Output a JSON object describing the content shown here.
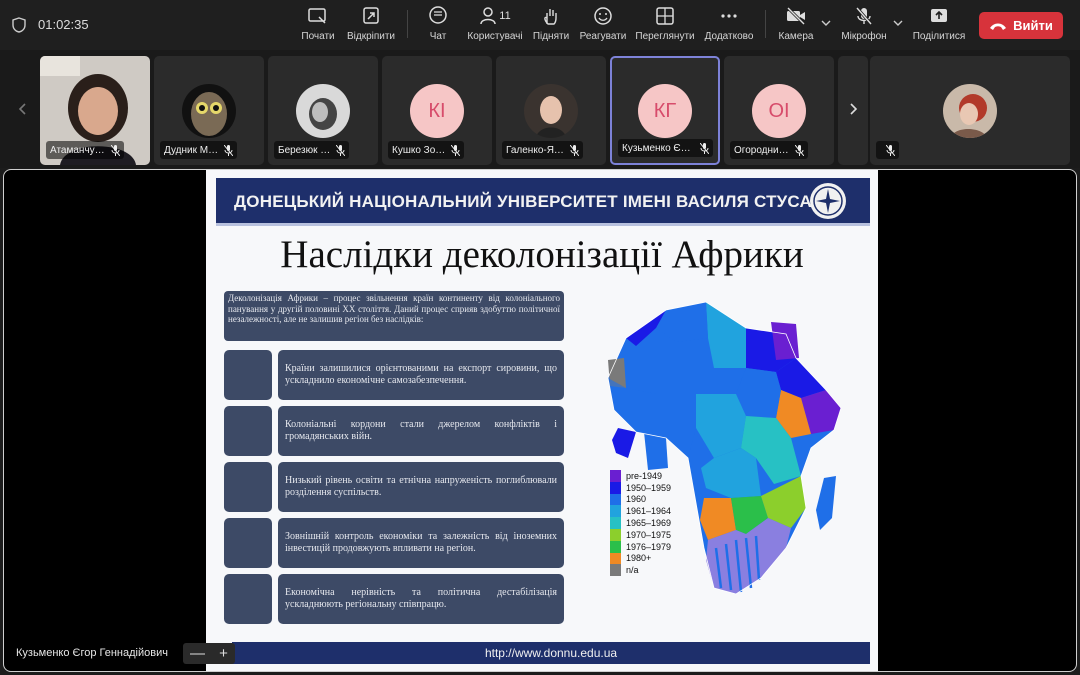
{
  "topbar": {
    "timer": "01:02:35",
    "tools": [
      {
        "label": "Почати",
        "icon": "record-screen-icon"
      },
      {
        "label": "Відкріпити",
        "icon": "unpin-icon"
      },
      {
        "label": "Чат",
        "icon": "chat-icon"
      },
      {
        "label": "Користувачі",
        "icon": "users-icon",
        "count": "11"
      },
      {
        "label": "Підняти",
        "icon": "raise-hand-icon"
      },
      {
        "label": "Реагувати",
        "icon": "smile-icon"
      },
      {
        "label": "Переглянути",
        "icon": "grid-view-icon"
      },
      {
        "label": "Додатково",
        "icon": "more-icon"
      },
      {
        "label": "Камера",
        "icon": "camera-off-icon"
      },
      {
        "label": "Мікрофон",
        "icon": "mic-off-icon"
      },
      {
        "label": "Поділитися",
        "icon": "share-screen-icon"
      }
    ],
    "leave_label": "Вийти"
  },
  "participants": [
    {
      "name": "Атаманчу…",
      "type": "photo"
    },
    {
      "name": "Дудник М…",
      "type": "photo"
    },
    {
      "name": "Березюк …",
      "type": "photo"
    },
    {
      "name": "Кушко Зо…",
      "type": "initials",
      "initials": "КІ"
    },
    {
      "name": "Галенко-Я…",
      "type": "photo"
    },
    {
      "name": "Кузьменко Єг…",
      "type": "initials",
      "initials": "КГ",
      "active": true
    },
    {
      "name": "Огородни…",
      "type": "initials",
      "initials": "ОІ"
    },
    {
      "name": "",
      "type": "photo"
    }
  ],
  "slide": {
    "banner": "ДОНЕЦЬКИЙ НАЦІОНАЛЬНИЙ УНІВЕРСИТЕТ ІМЕНІ ВАСИЛЯ СТУСА",
    "title": "Наслідки деколонізації Африки",
    "intro": "Деколонізація Африки – процес звільнення країн континенту від колоніального панування у другій половині XX століття. Даний процес сприяв здобуттю політичної незалежності, але не залишив регіон без наслідків:",
    "points": [
      "Країни залишилися орієнтованими на експорт сировини, що ускладнило економічне самозабезпечення.",
      "Колоніальні кордони стали джерелом конфліктів і громадянських війн.",
      "Низький рівень освіти та етнічна напруженість поглиблювали розділення суспільств.",
      "Зовнішній контроль економіки та залежність від іноземних інвестицій продовжують впливати на регіон.",
      "Економічна нерівність та політична дестабілізація ускладнюють регіональну співпрацю."
    ],
    "legend": [
      {
        "label": "pre-1949",
        "color": "#6a1fd1"
      },
      {
        "label": "1950–1959",
        "color": "#1a1ae6"
      },
      {
        "label": "1960",
        "color": "#1f6fe8"
      },
      {
        "label": "1961–1964",
        "color": "#21a3de"
      },
      {
        "label": "1965–1969",
        "color": "#27c1c4"
      },
      {
        "label": "1970–1975",
        "color": "#8ccf2c"
      },
      {
        "label": "1976–1979",
        "color": "#2bbf4a"
      },
      {
        "label": "1980+",
        "color": "#f08a24"
      },
      {
        "label": "n/a",
        "color": "#7a7a7a"
      }
    ],
    "footer": "http://www.donnu.edu.ua"
  },
  "speaker_name": "Кузьменко Єгор Геннадійович",
  "zoom_controls": {
    "minus": "—",
    "plus": "+"
  }
}
